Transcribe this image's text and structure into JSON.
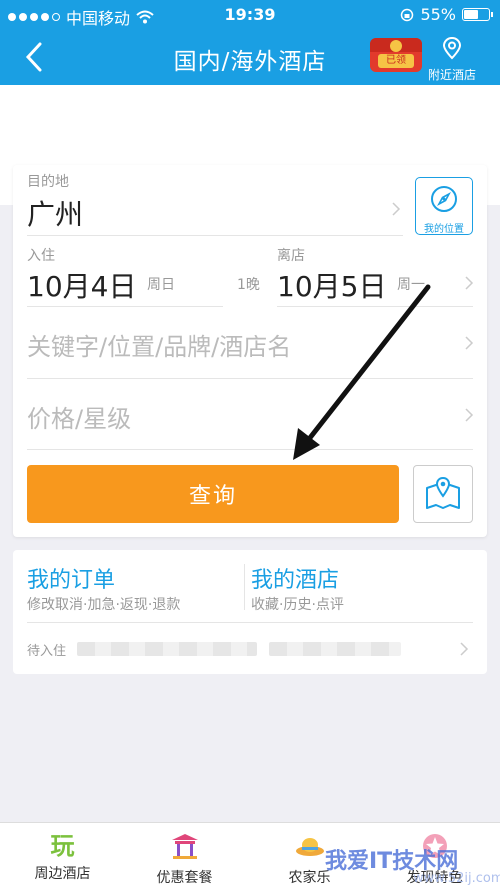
{
  "status": {
    "carrier": "中国移动",
    "time": "19:39",
    "battery": "55%"
  },
  "nav": {
    "title": "国内/海外酒店",
    "redpacket_label": "已领",
    "nearby_label": "附近酒店"
  },
  "form": {
    "destination_label": "目的地",
    "destination_value": "广州",
    "my_location_label": "我的位置",
    "checkin_label": "入住",
    "checkin_date": "10月4日",
    "checkin_week": "周日",
    "nights": "1晚",
    "checkout_label": "离店",
    "checkout_date": "10月5日",
    "checkout_week": "周一",
    "keyword_placeholder": "关键字/位置/品牌/酒店名",
    "price_placeholder": "价格/星级",
    "search_button": "查询"
  },
  "orders": {
    "my_orders_title": "我的订单",
    "my_orders_sub": "修改取消·加急·返现·退款",
    "my_hotels_title": "我的酒店",
    "my_hotels_sub": "收藏·历史·点评",
    "pending_label": "待入住"
  },
  "tabs": [
    {
      "label": "周边酒店",
      "icon": "wan-icon"
    },
    {
      "label": "优惠套餐",
      "icon": "pavilion-icon"
    },
    {
      "label": "农家乐",
      "icon": "hat-icon"
    },
    {
      "label": "发现特色",
      "icon": "star-icon"
    }
  ],
  "watermark": {
    "text": "我爱IT技术网",
    "url": "www.52ij.com"
  },
  "colors": {
    "brand_blue": "#1a9fe3",
    "search_orange": "#f8981d"
  }
}
